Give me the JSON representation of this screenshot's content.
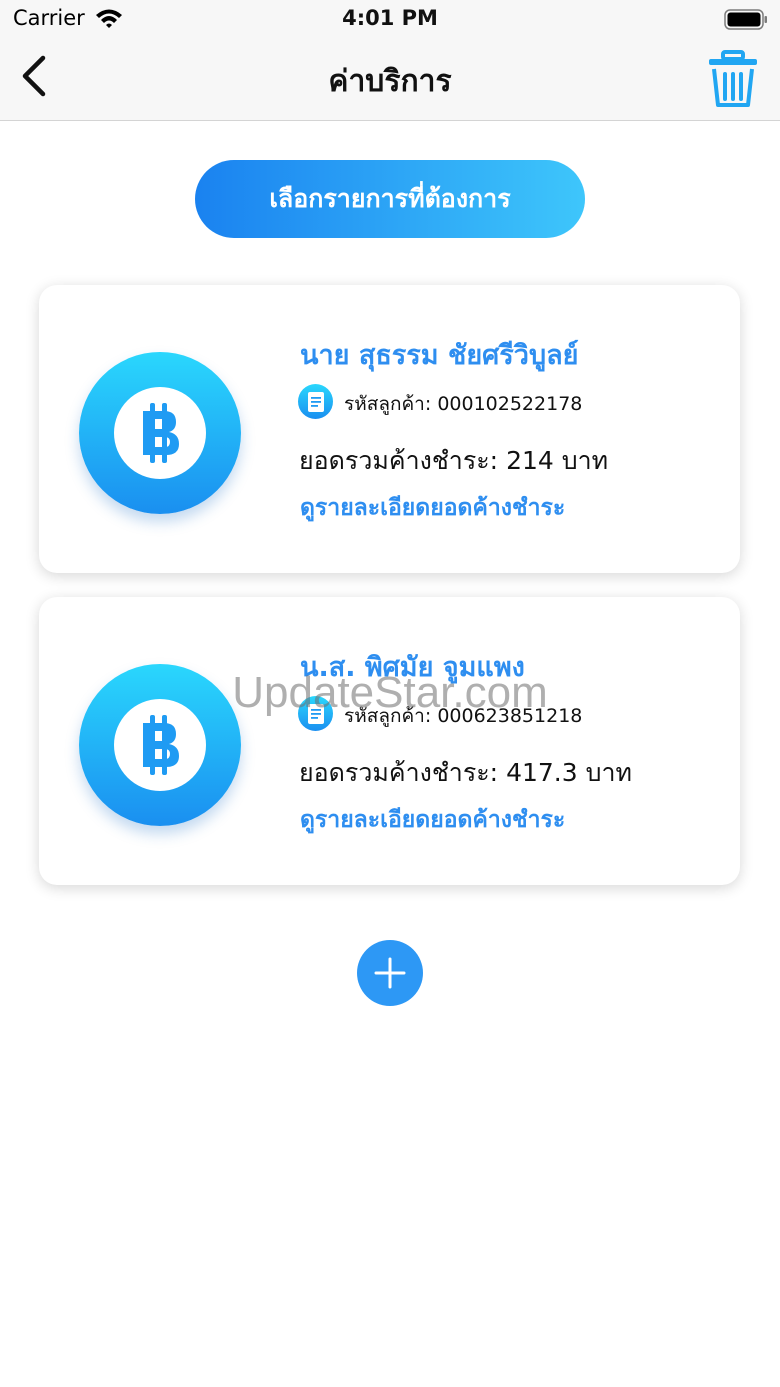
{
  "status_bar": {
    "carrier": "Carrier",
    "time": "4:01 PM",
    "icons": [
      "wifi-icon",
      "battery-icon"
    ]
  },
  "nav": {
    "title": "ค่าบริการ",
    "back_icon": "chevron-left-icon",
    "delete_icon": "trash-icon"
  },
  "select_button": {
    "label": "เลือกรายการที่ต้องการ"
  },
  "customers": [
    {
      "name": "นาย สุธรรม ชัยศรีวิบูลย์",
      "id_label": "รหัสลูกค้า:",
      "id_value": "000102522178",
      "outstanding_label": "ยอดรวมค้างชำระ:",
      "outstanding_value": "214",
      "currency": "บาท",
      "details_link": "ดูรายละเอียดยอดค้างชำระ"
    },
    {
      "name": "น.ส. พิศมัย จูมแพง",
      "id_label": "รหัสลูกค้า:",
      "id_value": "000623851218",
      "outstanding_label": "ยอดรวมค้างชำระ:",
      "outstanding_value": "417.3",
      "currency": "บาท",
      "details_link": "ดูรายละเอียดยอดค้างชำระ"
    }
  ],
  "add_button_icon": "plus-icon",
  "watermark": "UpdateStar.com",
  "colors": {
    "accent": "#2e8ef0",
    "gradient_start": "#1a82f0",
    "gradient_end": "#3ec6fb",
    "coin_top": "#2ad7fd",
    "coin_bottom": "#1a8ff0",
    "add_button": "#2d98f5"
  }
}
